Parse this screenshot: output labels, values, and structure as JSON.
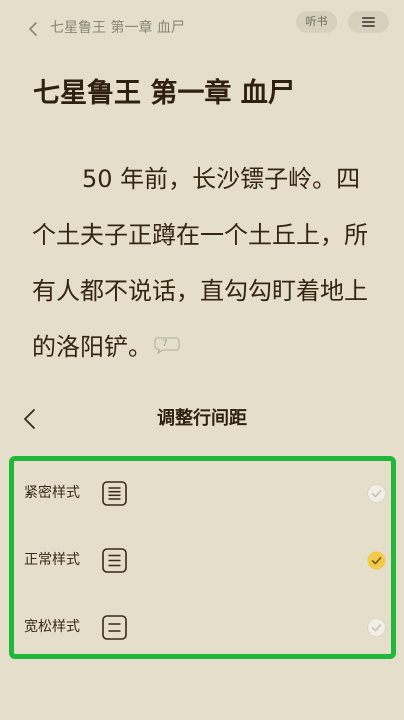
{
  "header": {
    "breadcrumb": "七星鲁王 第一章 血尸",
    "listen_label": "听书"
  },
  "chapter": {
    "title": "七星鲁王 第一章 血尸",
    "paragraph": "50 年前，长沙镖子岭。四个土夫子正蹲在一个土丘上，所有人都不说话，直勾勾盯着地上的洛阳铲。",
    "note_count": "7"
  },
  "panel": {
    "title": "调整行间距",
    "options": [
      {
        "label": "紧密样式",
        "icon": "compact-spacing-icon",
        "selected": false
      },
      {
        "label": "正常样式",
        "icon": "normal-spacing-icon",
        "selected": true
      },
      {
        "label": "宽松样式",
        "icon": "loose-spacing-icon",
        "selected": false
      }
    ]
  },
  "colors": {
    "background": "#e4decb",
    "highlight_border": "#1fb83a",
    "selected_check": "#f3c94a"
  }
}
